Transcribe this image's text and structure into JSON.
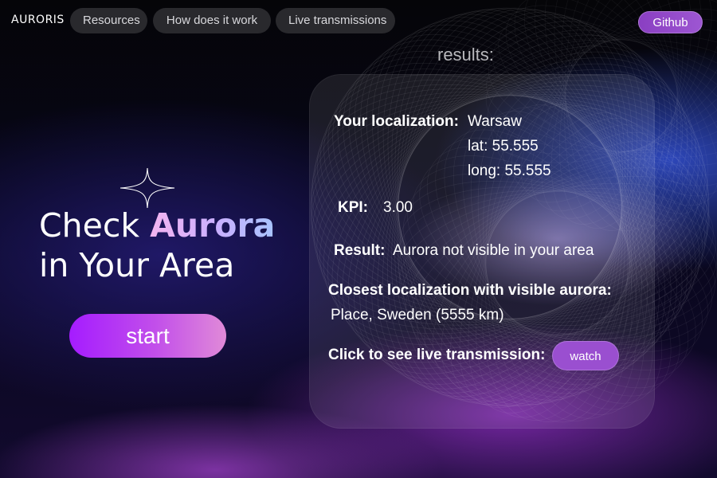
{
  "header": {
    "brand": "AURORIS",
    "nav": [
      "Resources",
      "How does it work",
      "Live transmissions"
    ],
    "github_label": "Github"
  },
  "hero": {
    "title_line1_prefix": "Check ",
    "title_line1_accent": "Aurora",
    "title_line2": "in Your Area",
    "start_label": "start"
  },
  "results": {
    "heading": "results:",
    "localization_label": "Your localization:",
    "city": "Warsaw",
    "lat": "lat: 55.555",
    "long": "long: 55.555",
    "kpi_label": "KPI:",
    "kpi_value": "3.00",
    "result_label": "Result:",
    "result_value": "Aurora not visible in your area",
    "closest_label": "Closest localization with visible aurora:",
    "closest_value": "Place, Sweden (5555 km)",
    "live_label": "Click to see live transmission:",
    "watch_label": "watch"
  },
  "colors": {
    "accent_purple": "#9a4fd0",
    "start_gradient_start": "#a51cff",
    "start_gradient_end": "#e08ad8"
  },
  "icons": {
    "sparkle": "four-point-star-icon"
  }
}
